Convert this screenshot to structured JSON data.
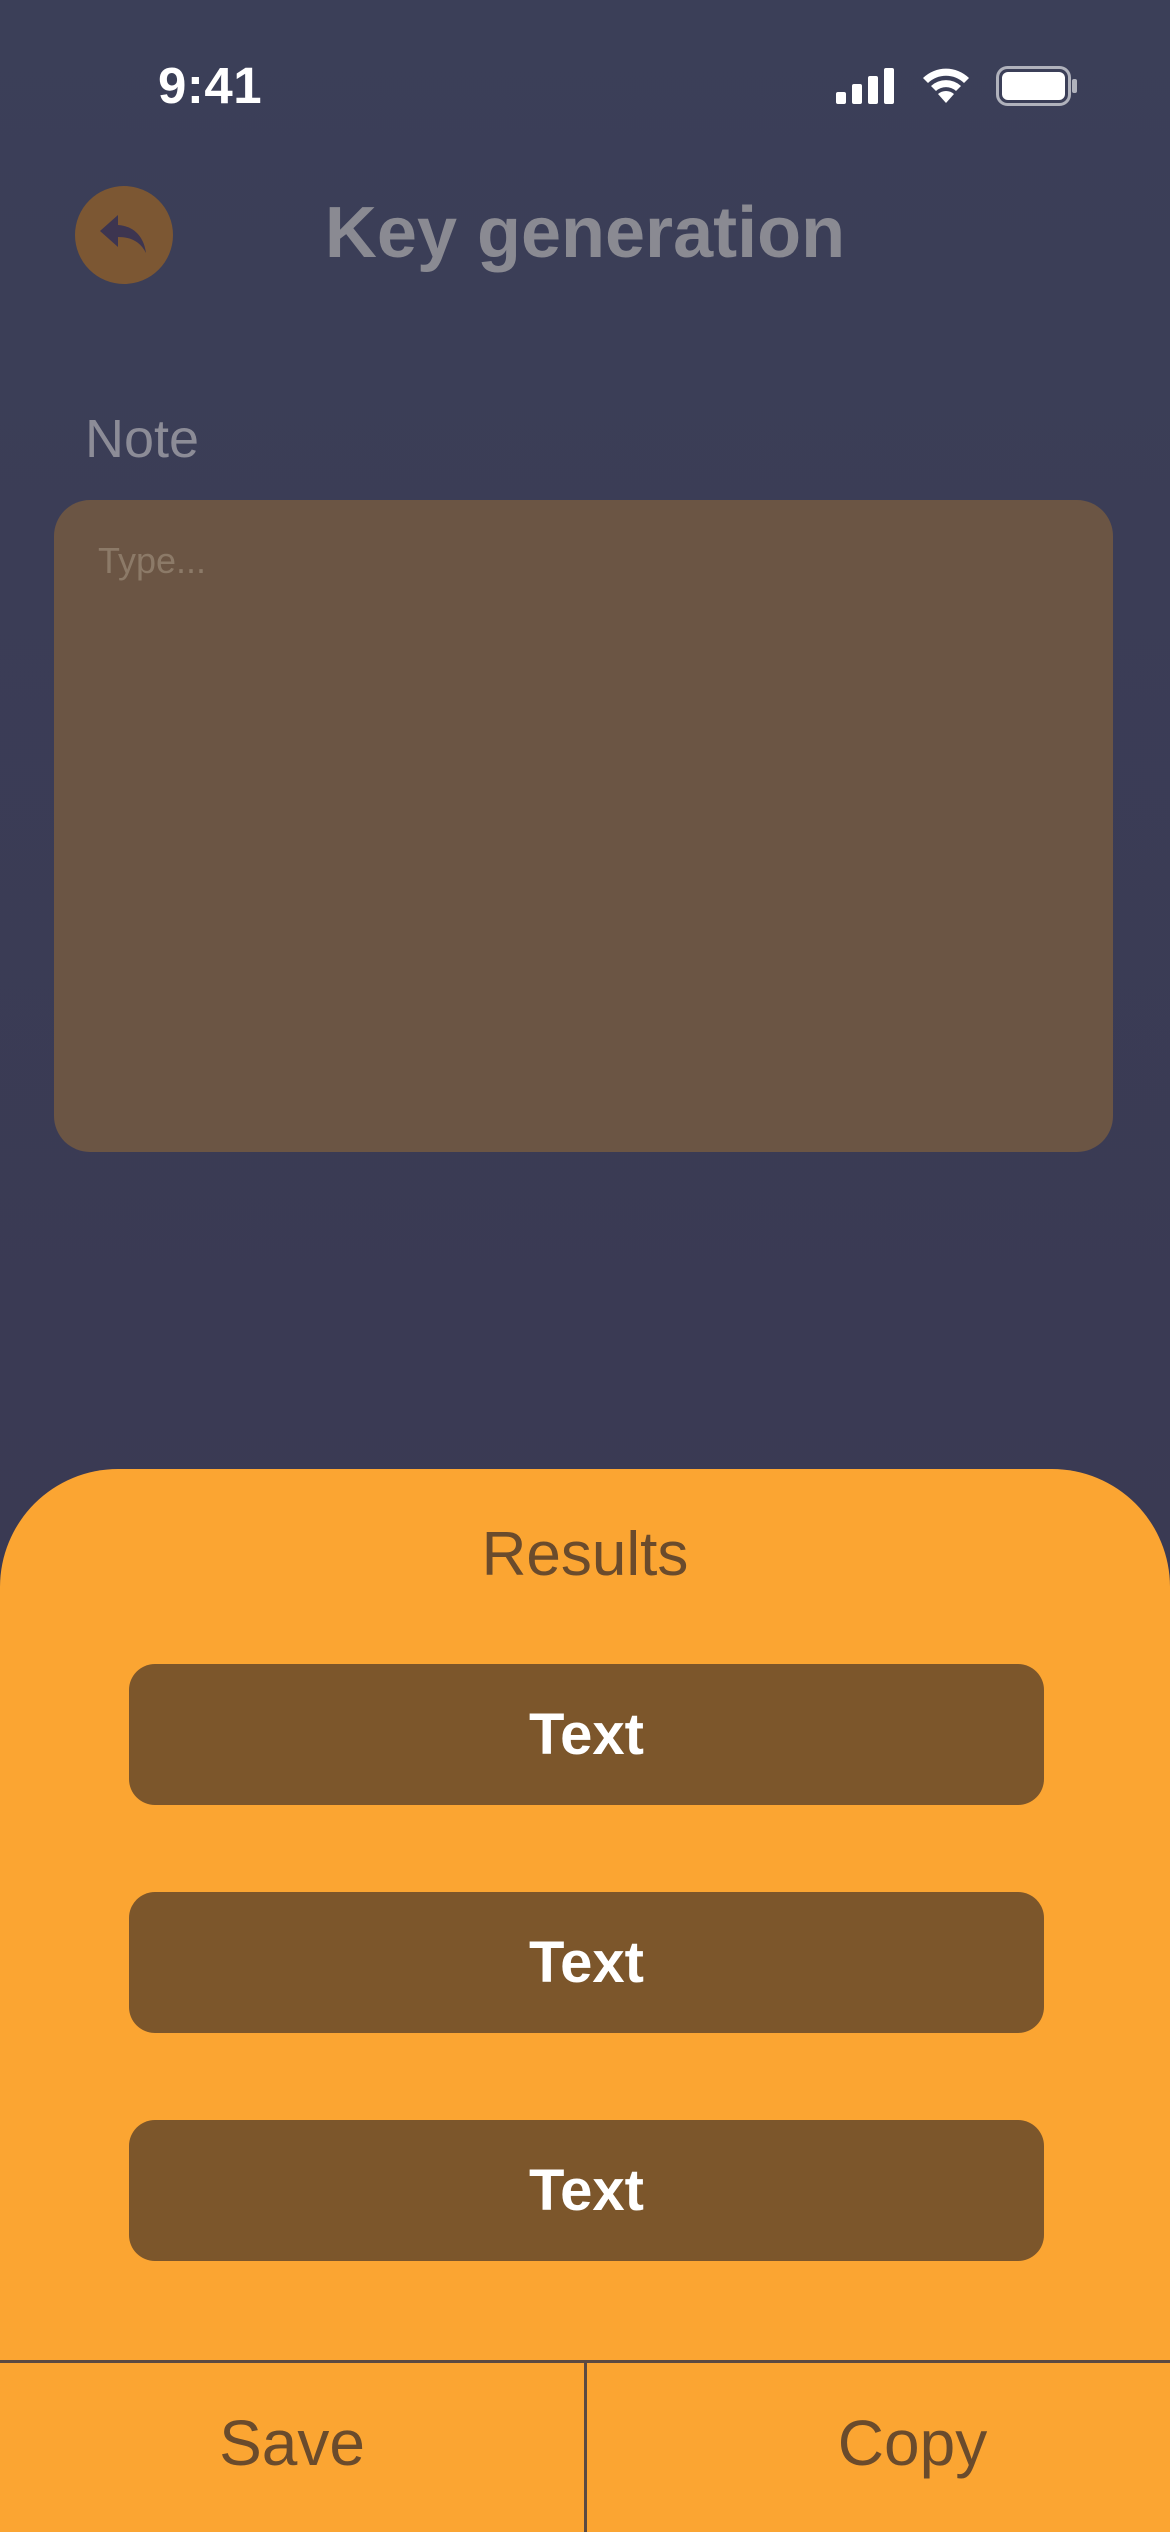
{
  "status_bar": {
    "time": "9:41",
    "icons": [
      "cellular-signal-icon",
      "wifi-icon",
      "battery-icon"
    ]
  },
  "header": {
    "title": "Key generation",
    "back_icon": "reply-arrow-icon"
  },
  "note": {
    "label": "Note",
    "placeholder": "Type...",
    "value": ""
  },
  "results": {
    "title": "Results",
    "items": [
      {
        "label": "Text"
      },
      {
        "label": "Text"
      },
      {
        "label": "Text"
      }
    ]
  },
  "footer": {
    "save_label": "Save",
    "copy_label": "Copy"
  },
  "colors": {
    "background": "#3B3F58",
    "accent": "#FBA532",
    "result_button": "#7C562B",
    "note_box": "#6B5544",
    "back_button": "#7C5733"
  }
}
